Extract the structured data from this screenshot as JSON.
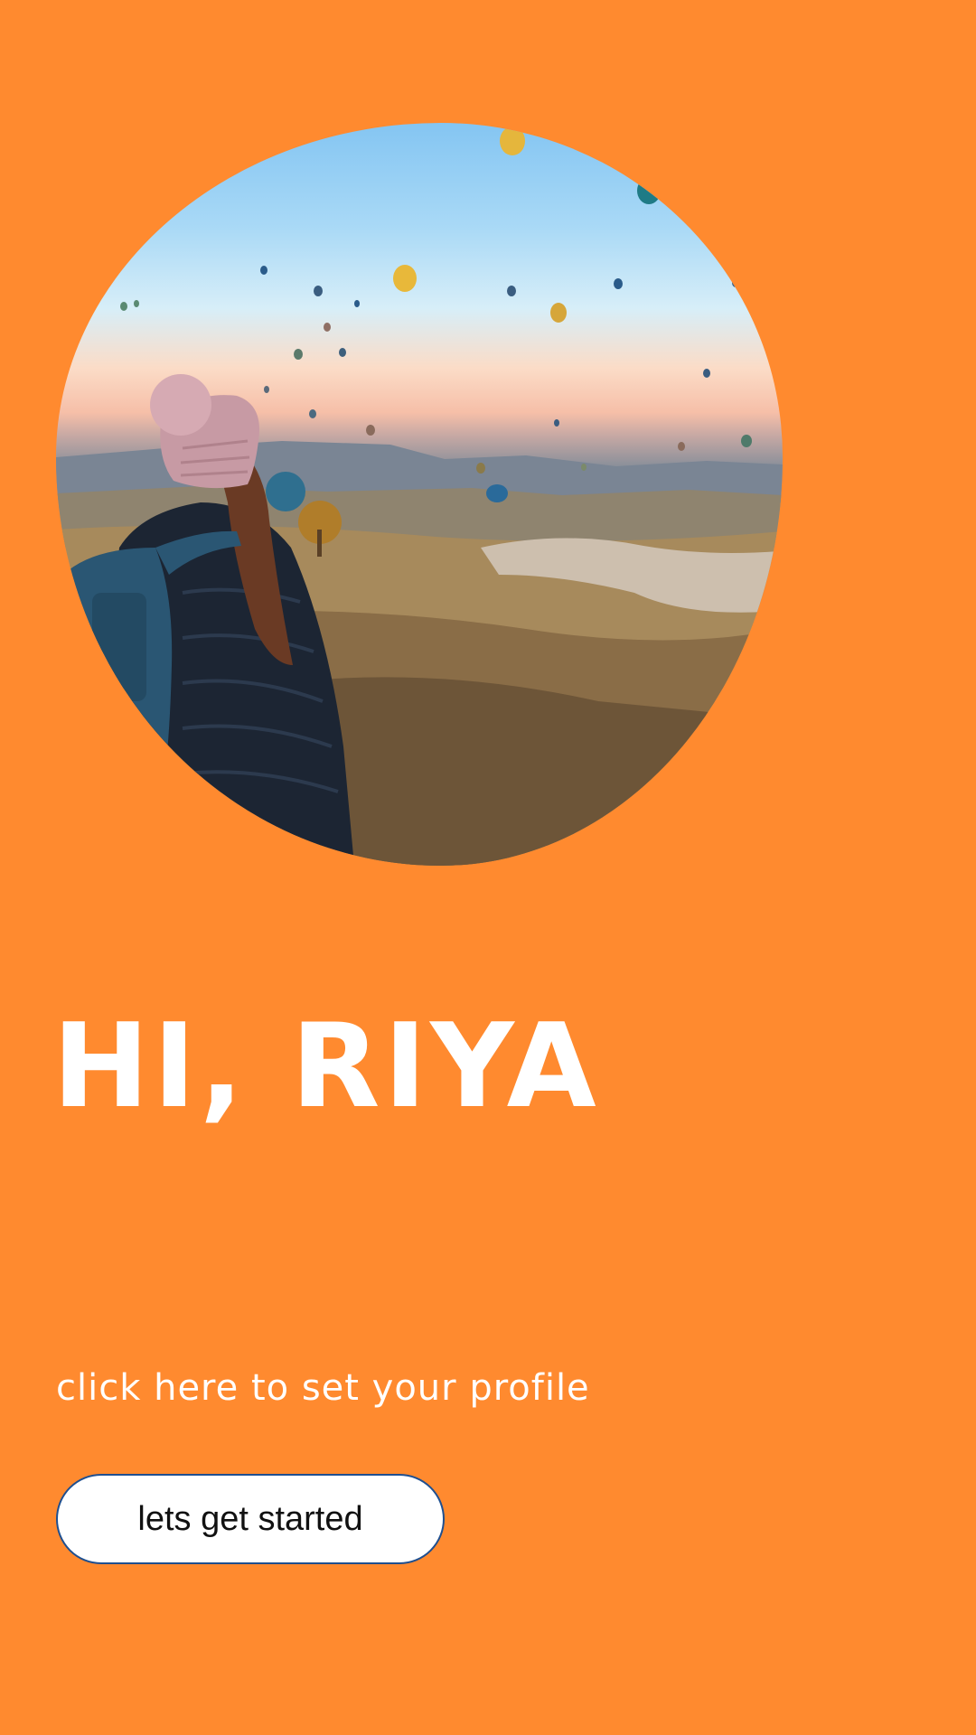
{
  "hero": {
    "image_icon": "photo-traveler-balloons"
  },
  "greeting": {
    "title": "HI, RIYA"
  },
  "profile": {
    "link_text": "click here to set your profile"
  },
  "actions": {
    "start_label": "lets get started"
  },
  "colors": {
    "background": "#ff8a2f",
    "button_bg": "#ffffff",
    "button_border": "#1f4f8f",
    "text": "#ffffff"
  }
}
